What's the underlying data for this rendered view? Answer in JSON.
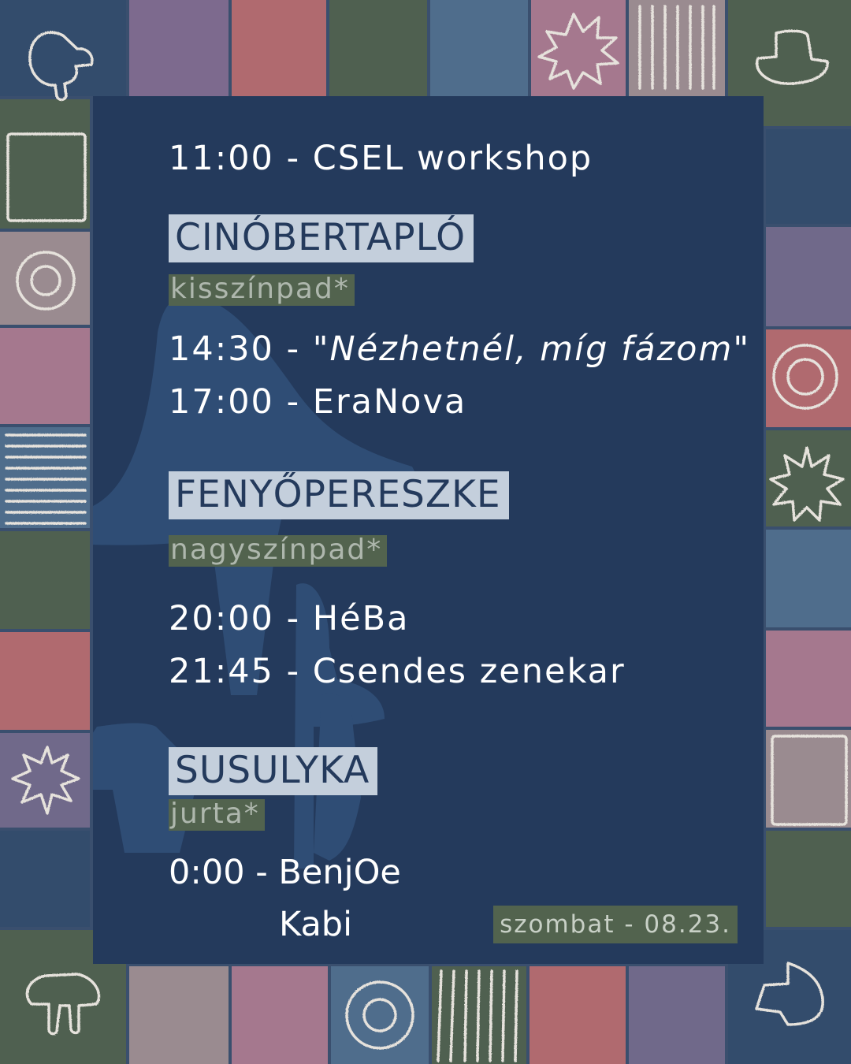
{
  "schedule": {
    "opening": {
      "time": "11:00",
      "title": "CSEL workshop"
    },
    "venues": [
      {
        "name": "CINÓBERTAPLÓ",
        "type": "kisszínpad*",
        "acts": [
          {
            "time": "14:30",
            "title": "\"Nézhetnél, míg fázom\""
          },
          {
            "time": "17:00",
            "title": "EraNova"
          }
        ]
      },
      {
        "name": "FENYŐPERESZKE",
        "type": "nagyszínpad*",
        "acts": [
          {
            "time": "20:00",
            "title": "HéBa"
          },
          {
            "time": "21:45",
            "title": "Csendes zenekar"
          }
        ]
      },
      {
        "name": "SUSULYKA",
        "type": "jurta*",
        "acts": [
          {
            "time": "0:00",
            "title": "BenjOe",
            "title_line2": "Kabi"
          }
        ]
      }
    ],
    "date_label": "szombat - 08.23."
  },
  "colors": {
    "panel": "#243a5c",
    "venue_bg": "#c4cfdc",
    "sub_bg": "#52634e",
    "tile_palette": [
      "#334c6c",
      "#7d6a8e",
      "#b06a6f",
      "#4f6050",
      "#4f6d8c",
      "#a5788e",
      "#9a8b90",
      "#70698a"
    ]
  },
  "icons": [
    "mushroom-icon",
    "sun-burst-icon",
    "ring-icon",
    "square-outline-icon",
    "stripes-icon"
  ]
}
